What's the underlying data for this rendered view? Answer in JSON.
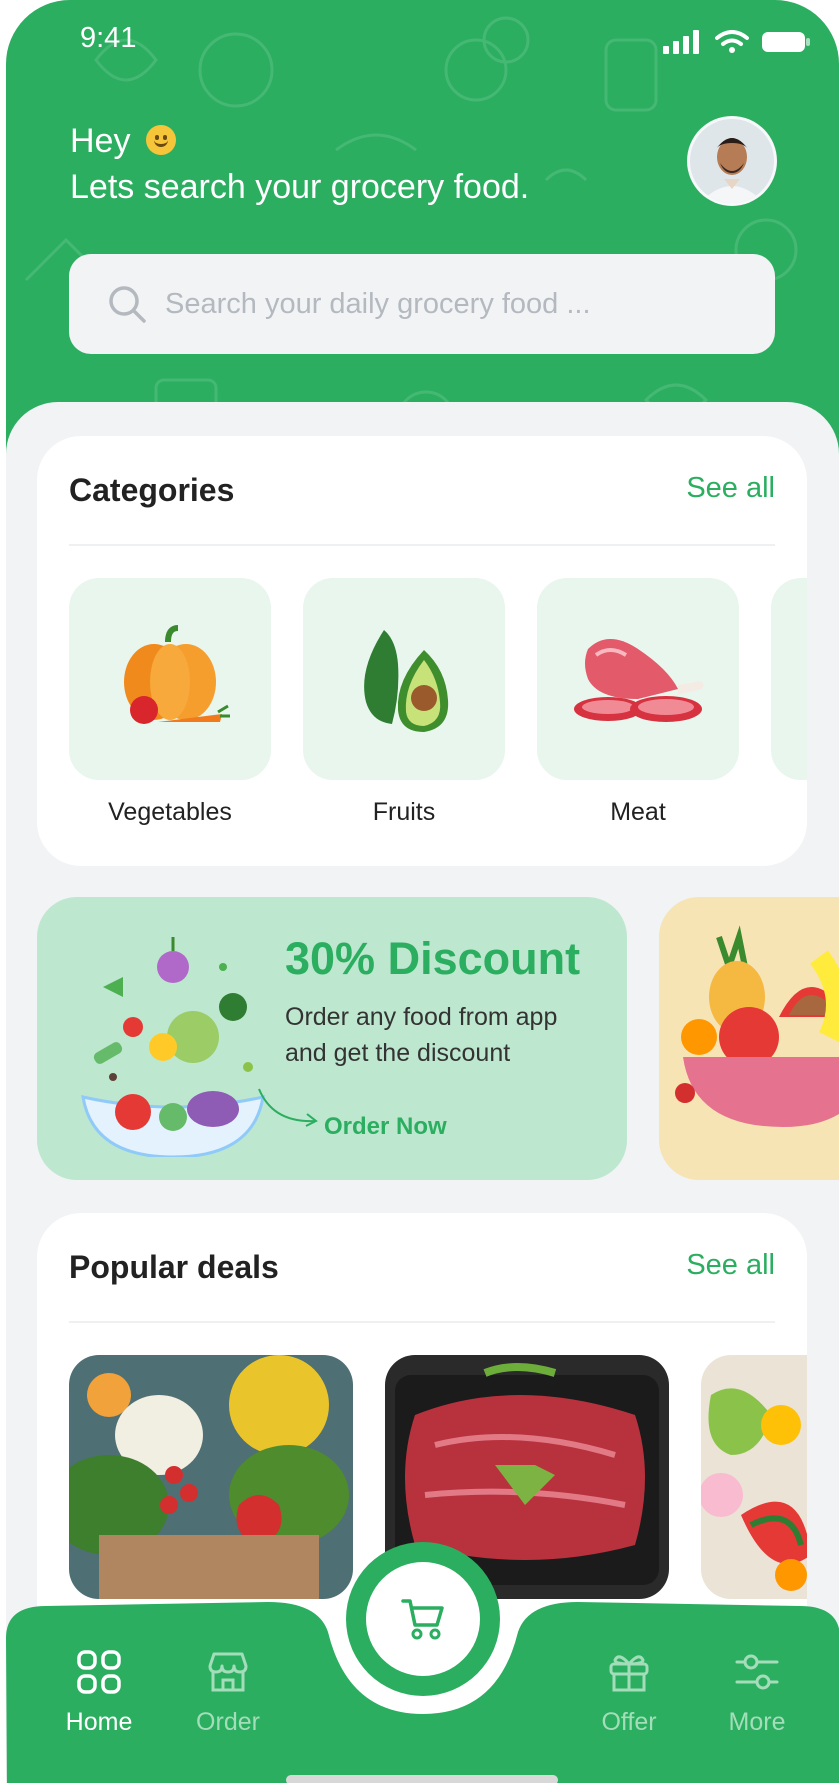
{
  "status_bar": {
    "time": "9:41"
  },
  "header": {
    "greeting": "Hey",
    "subtitle": "Lets search your grocery food."
  },
  "search": {
    "placeholder": "Search your daily grocery food ..."
  },
  "categories": {
    "title": "Categories",
    "see_all": "See all",
    "items": [
      {
        "label": "Vegetables",
        "icon": "pumpkin-icon"
      },
      {
        "label": "Fruits",
        "icon": "avocado-icon"
      },
      {
        "label": "Meat",
        "icon": "meat-icon"
      }
    ]
  },
  "promo": {
    "title": "30% Discount",
    "text": "Order any food from app and get the discount",
    "cta": "Order Now"
  },
  "popular": {
    "title": "Popular deals",
    "see_all": "See all"
  },
  "tabbar": {
    "items": [
      {
        "label": "Home",
        "icon": "grid-icon",
        "active": true
      },
      {
        "label": "Order",
        "icon": "store-icon",
        "active": false
      },
      {
        "label": "Offer",
        "icon": "gift-icon",
        "active": false
      },
      {
        "label": "More",
        "icon": "sliders-icon",
        "active": false
      }
    ],
    "center_icon": "cart-icon"
  },
  "colors": {
    "primary": "#2BAE60",
    "tile": "#E8F6EE",
    "banner": "#BDE7CF",
    "banner2": "#F7E4B5"
  }
}
